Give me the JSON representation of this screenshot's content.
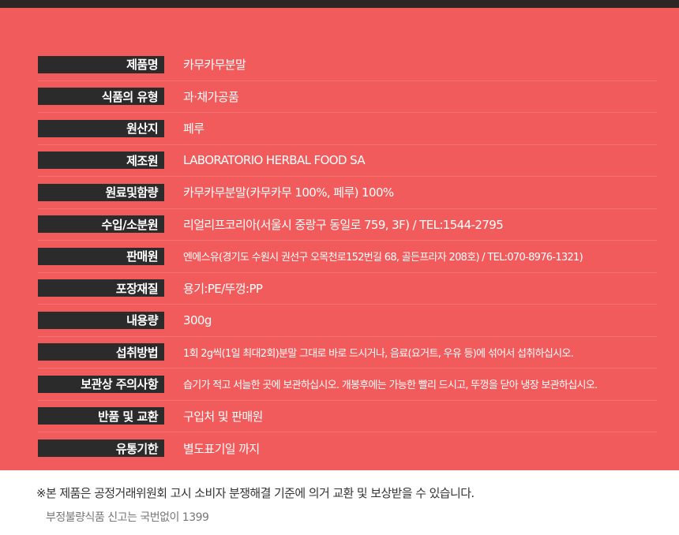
{
  "rows": [
    {
      "label": "제품명",
      "value": "카무카무분말"
    },
    {
      "label": "식품의 유형",
      "value": "과·채가공품"
    },
    {
      "label": "원산지",
      "value": "페루"
    },
    {
      "label": "제조원",
      "value": "LABORATORIO HERBAL FOOD SA"
    },
    {
      "label": "원료및함량",
      "value": "카무카무분말(카무카무 100%, 페루) 100%"
    },
    {
      "label": "수입/소분원",
      "value": "리얼리프코리아(서울시 중랑구 동일로 759, 3F) / TEL:1544-2795"
    },
    {
      "label": "판매원",
      "value": "엔에스유(경기도 수원시 권선구 오목천로152번길 68, 골든프라자 208호) / TEL:070-8976-1321)"
    },
    {
      "label": "포장재질",
      "value": "용기:PE/뚜껑:PP"
    },
    {
      "label": "내용량",
      "value": "300g"
    },
    {
      "label": "섭취방법",
      "value": "1회 2g씩(1일 최대2회)분말 그대로 바로 드시거나, 음료(요거트, 우유 등)에 섞어서 섭취하십시오."
    },
    {
      "label": "보관상 주의사항",
      "value": "습기가 적고 서늘한 곳에 보관하십시오. 개봉후에는 가능한 빨리 드시고, 뚜껑을 닫아 냉장 보관하십시오."
    },
    {
      "label": "반품 및 교환",
      "value": "구입처 및 판매원"
    },
    {
      "label": "유통기한",
      "value": "별도표기일 까지"
    }
  ],
  "notes": {
    "line1": "※본 제품은 공정거래위원회 고시 소비자 분쟁해결 기준에 의거 교환 및 보상받을 수 있습니다.",
    "line2": "부정불량식품 신고는 국번없이 1399"
  }
}
